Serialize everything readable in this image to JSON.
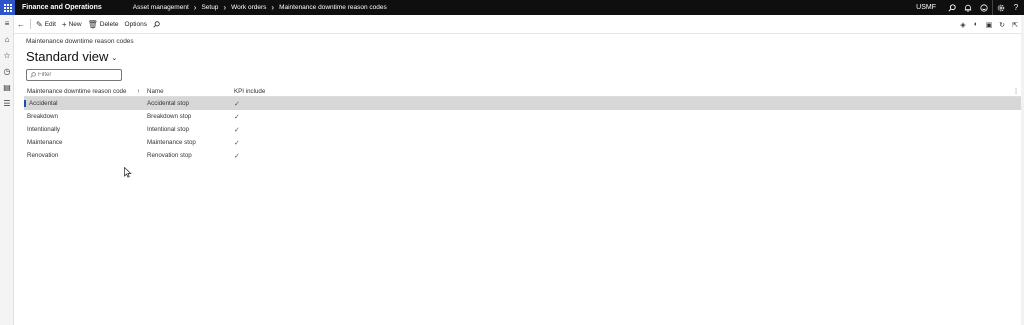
{
  "topbar": {
    "app_name": "Finance and Operations",
    "breadcrumbs": [
      "Asset management",
      "Setup",
      "Work orders",
      "Maintenance downtime reason codes"
    ],
    "company": "USMF"
  },
  "actions": {
    "edit": "Edit",
    "new": "New",
    "delete": "Delete",
    "options": "Options"
  },
  "page": {
    "caption": "Maintenance downtime reason codes",
    "view_name": "Standard view",
    "filter_placeholder": "Filter"
  },
  "grid": {
    "columns": [
      "Maintenance downtime reason code",
      "Name",
      "KPI include"
    ],
    "sort_indicator": "↑",
    "rows": [
      {
        "code": "Accidental",
        "name": "Accidental stop",
        "kpi": "✓"
      },
      {
        "code": "Breakdown",
        "name": "Breakdown stop",
        "kpi": "✓"
      },
      {
        "code": "Intentionally",
        "name": "Intentional stop",
        "kpi": "✓"
      },
      {
        "code": "Maintenance",
        "name": "Maintenance stop",
        "kpi": "✓"
      },
      {
        "code": "Renovation",
        "name": "Renovation stop",
        "kpi": "✓"
      }
    ]
  },
  "colors": {
    "topbar": "#0f0f0f",
    "waffle": "#2d55c8",
    "selected_row": "#d7d7d7",
    "accent": "#1a4fa5"
  }
}
